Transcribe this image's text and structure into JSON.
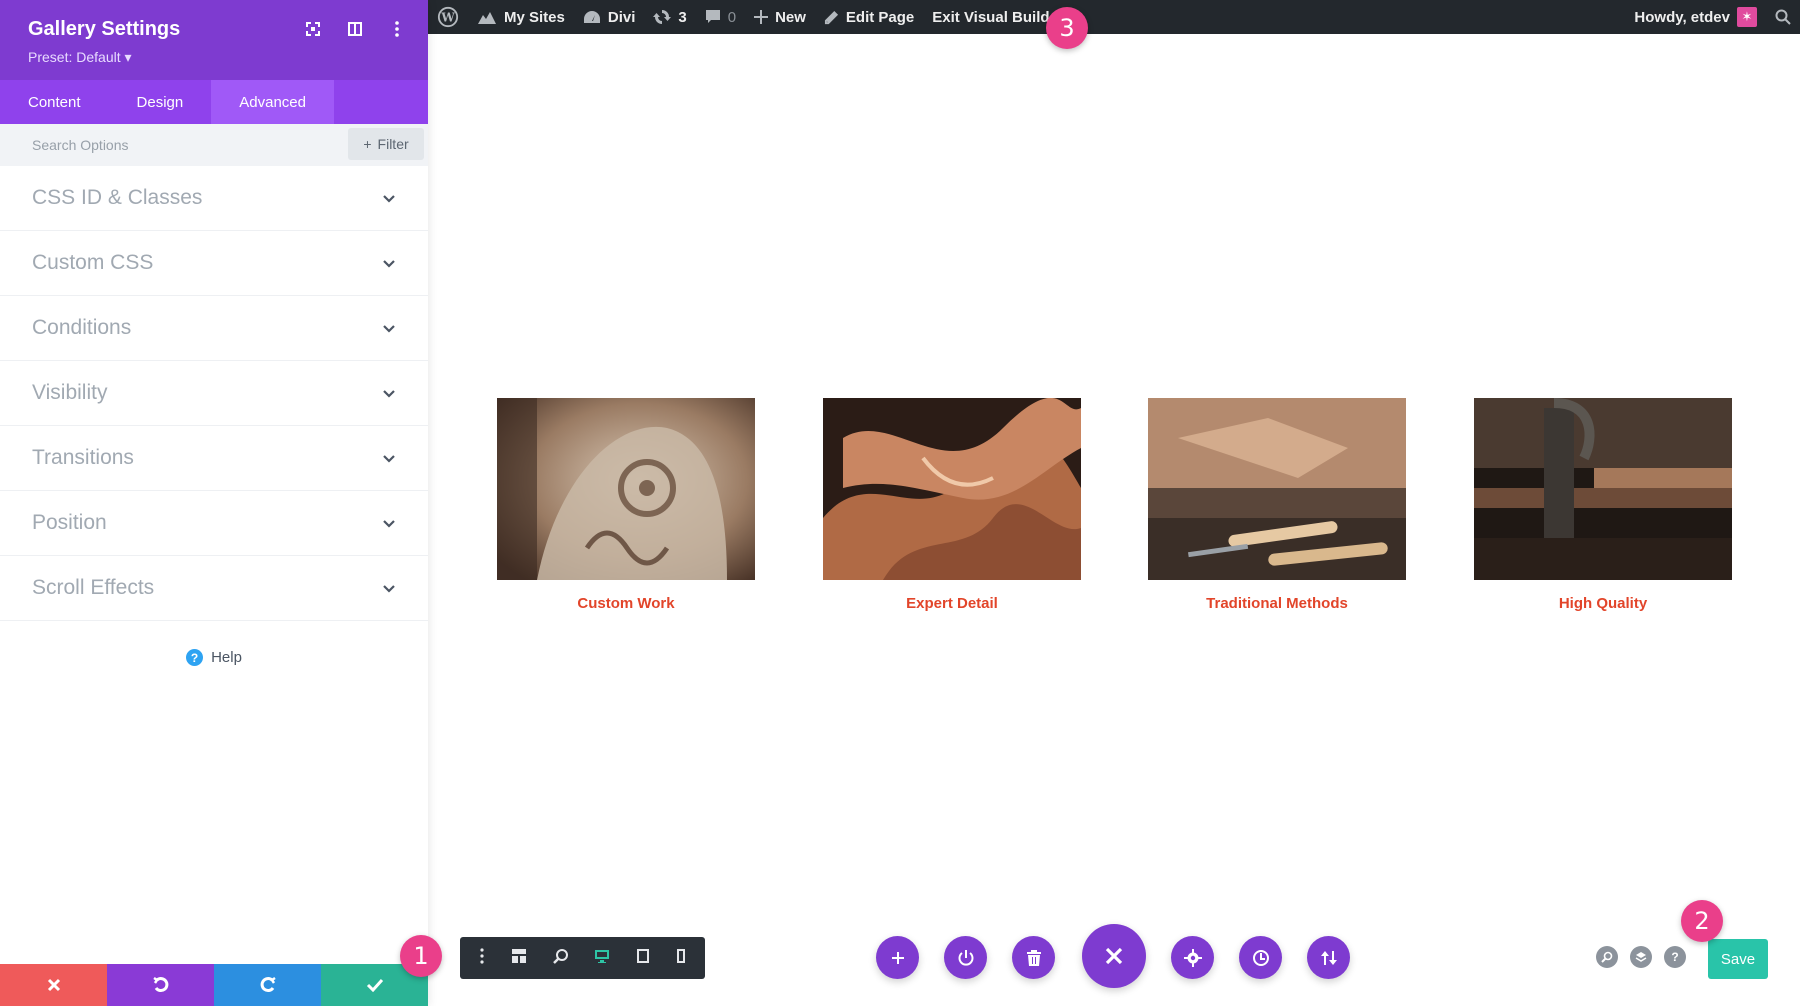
{
  "admin_bar": {
    "my_sites": "My Sites",
    "divi": "Divi",
    "updates_count": "3",
    "comments_count": "0",
    "new": "New",
    "edit_page": "Edit Page",
    "exit_vb": "Exit Visual Builder",
    "howdy": "Howdy, etdev"
  },
  "panel": {
    "title": "Gallery Settings",
    "preset": "Preset: Default ▾",
    "tabs": [
      {
        "label": "Content",
        "active": false
      },
      {
        "label": "Design",
        "active": false
      },
      {
        "label": "Advanced",
        "active": true
      }
    ],
    "search_placeholder": "Search Options",
    "filter_label": "Filter",
    "toggles": [
      "CSS ID & Classes",
      "Custom CSS",
      "Conditions",
      "Visibility",
      "Transitions",
      "Position",
      "Scroll Effects"
    ],
    "help": "Help",
    "footer_colors": {
      "cancel": "#ef5a5a",
      "undo": "#8a3ad6",
      "redo": "#2c8fe0",
      "confirm": "#2ab395"
    }
  },
  "gallery": [
    {
      "caption": "Custom Work"
    },
    {
      "caption": "Expert Detail"
    },
    {
      "caption": "Traditional Methods"
    },
    {
      "caption": "High Quality"
    }
  ],
  "save_label": "Save",
  "badges": [
    "1",
    "2",
    "3"
  ],
  "colors": {
    "purple": "#7e3bd0",
    "accent_green": "#29c4a9",
    "caption_red": "#e2452a",
    "badge_pink": "#ea3f8a"
  }
}
